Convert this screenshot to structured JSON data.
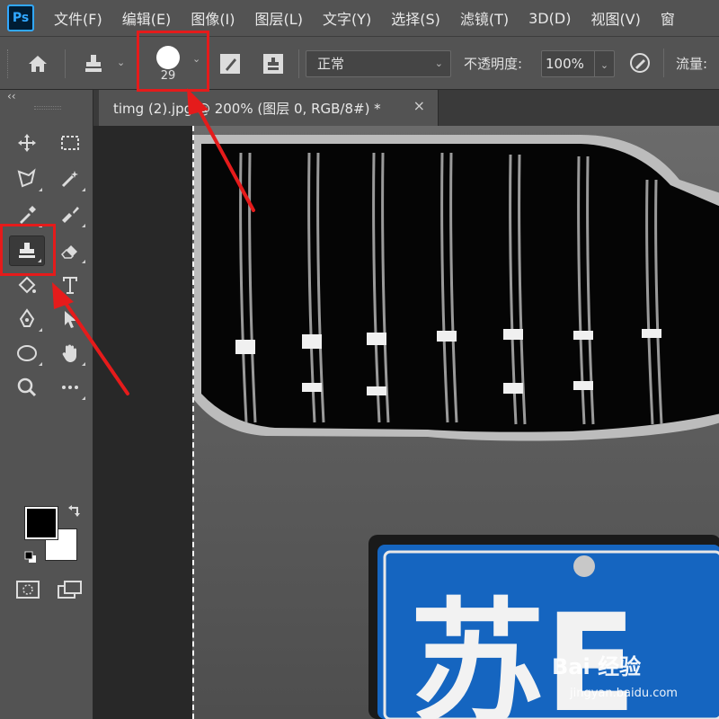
{
  "app": {
    "logo": "Ps"
  },
  "menu": [
    "文件(F)",
    "编辑(E)",
    "图像(I)",
    "图层(L)",
    "文字(Y)",
    "选择(S)",
    "滤镜(T)",
    "3D(D)",
    "视图(V)",
    "窗"
  ],
  "options_bar": {
    "brush_size": "29",
    "mode_value": "正常",
    "opacity_label": "不透明度:",
    "opacity_value": "100%",
    "flow_label": "流量:"
  },
  "toolbar": {
    "collapse": "‹‹",
    "active_tool": "clone-stamp",
    "foreground_color": "#000000",
    "background_color": "#ffffff"
  },
  "document": {
    "tab_title": "timg (2).jpg @ 200% (图层 0, RGB/8#) *",
    "close_glyph": "×"
  },
  "canvas": {
    "plate_text": "苏E"
  },
  "watermark": {
    "brand": "Bai 经验",
    "url": "jingyan.baidu.com"
  },
  "colors": {
    "ui_panel": "#535353",
    "ui_dark": "#282828",
    "highlight": "#e51b1b",
    "plate_blue": "#1565c0"
  }
}
